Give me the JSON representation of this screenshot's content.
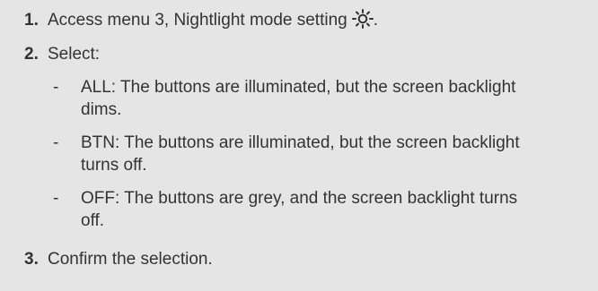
{
  "steps": [
    {
      "number": "1.",
      "text": "Access menu 3, Nightlight mode setting",
      "icon": "nightlight-sun-icon",
      "suffix": "."
    },
    {
      "number": "2.",
      "text": "Select:"
    },
    {
      "number": "3.",
      "text": "Confirm the selection."
    }
  ],
  "options": [
    {
      "bullet": "-",
      "text": "ALL: The buttons are illuminated, but the screen backlight dims."
    },
    {
      "bullet": "-",
      "text": "BTN: The buttons are illuminated, but the screen backlight turns off."
    },
    {
      "bullet": "-",
      "text": "OFF: The buttons are grey, and the screen backlight turns off."
    }
  ],
  "colors": {
    "background": "#e5e5e5",
    "text": "#333333"
  }
}
